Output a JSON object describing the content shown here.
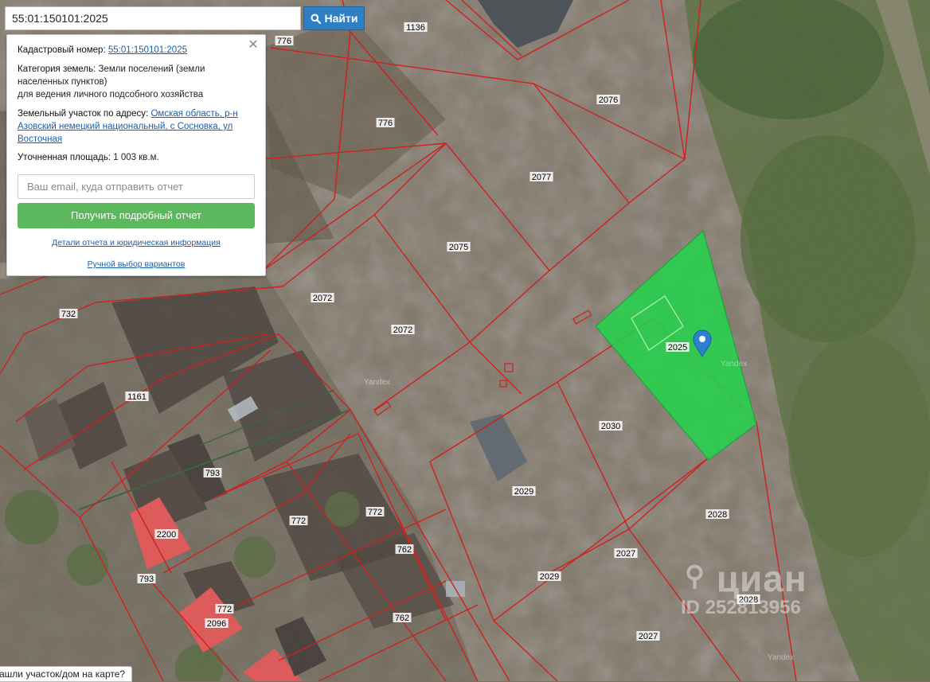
{
  "search": {
    "value": "55:01:150101:2025",
    "button_label": "Найти"
  },
  "info": {
    "cadastral_label": "Кадастровый номер:",
    "cadastral_value": "55:01:150101:2025",
    "category_label": "Категория земель:",
    "category_value": "Земли поселений (земли населенных пунктов)",
    "usage_value": "для ведения личного подсобного хозяйства",
    "address_label": "Земельный участок по адресу:",
    "address_value": "Омская область, р-н Азовский немецкий национальный, с Сосновка, ул Восточная",
    "area_label": "Уточненная площадь:",
    "area_value": "1 003 кв.м.",
    "email_placeholder": "Ваш email, куда отправить отчет",
    "report_button": "Получить подробный отчет",
    "details_link": "Детали отчета и юридическая информация",
    "manual_link": "Ручной выбор вариантов",
    "close_icon": "close-icon"
  },
  "bottom_tip": "ашли участок/дом на карте?",
  "map": {
    "plot_labels": [
      "776",
      "1136",
      "776",
      "2076",
      "2077",
      "2075",
      "2072",
      "2072",
      "732",
      "1161",
      "2025",
      "2030",
      "2029",
      "2028",
      "793",
      "772",
      "772",
      "2200",
      "793",
      "762",
      "2027",
      "2029",
      "772",
      "2096",
      "762",
      "2028",
      "2027"
    ],
    "watermarks": [
      "Yandex",
      "Yandex",
      "Yandex"
    ],
    "brand_watermark": "циан",
    "id_watermark": "ID 252813956",
    "colors": {
      "boundary": "#d0201e",
      "selected_plot": "#22d34a",
      "pin": "#2f7fd1",
      "roof_red": "#e0504f"
    },
    "pin_icon": "location-pin-icon"
  }
}
